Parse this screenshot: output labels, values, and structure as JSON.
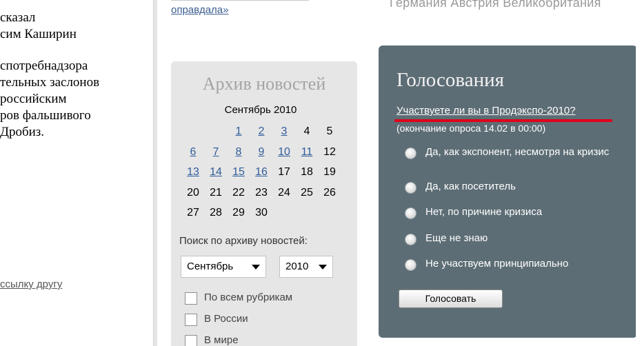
{
  "left_column": {
    "text_lines": [
      "сказал",
      "сим Каширин",
      "",
      "спотребнадзора",
      "тельных заслонов",
      "российским",
      "ров фальшивого",
      " Дробиз."
    ],
    "link": "ссылку другу"
  },
  "top": {
    "link_text": "оправдала»",
    "countries": "Германия  Австрия  Великобритания"
  },
  "archive": {
    "title": "Архив новостей",
    "month": "Сентябрь 2010",
    "calendar": [
      [
        {
          "d": "",
          "link": false
        },
        {
          "d": "",
          "link": false
        },
        {
          "d": "1",
          "link": true
        },
        {
          "d": "2",
          "link": true
        },
        {
          "d": "3",
          "link": true
        },
        {
          "d": "4",
          "link": false
        },
        {
          "d": "5",
          "link": false
        }
      ],
      [
        {
          "d": "6",
          "link": true
        },
        {
          "d": "7",
          "link": true
        },
        {
          "d": "8",
          "link": true
        },
        {
          "d": "9",
          "link": true
        },
        {
          "d": "10",
          "link": true
        },
        {
          "d": "11",
          "link": true
        },
        {
          "d": "12",
          "link": false
        }
      ],
      [
        {
          "d": "13",
          "link": true
        },
        {
          "d": "14",
          "link": true
        },
        {
          "d": "15",
          "link": true
        },
        {
          "d": "16",
          "link": true
        },
        {
          "d": "17",
          "link": false
        },
        {
          "d": "18",
          "link": false
        },
        {
          "d": "19",
          "link": false
        }
      ],
      [
        {
          "d": "20",
          "link": false
        },
        {
          "d": "21",
          "link": false
        },
        {
          "d": "22",
          "link": false
        },
        {
          "d": "23",
          "link": false
        },
        {
          "d": "24",
          "link": false
        },
        {
          "d": "25",
          "link": false
        },
        {
          "d": "26",
          "link": false
        }
      ],
      [
        {
          "d": "27",
          "link": false
        },
        {
          "d": "28",
          "link": false
        },
        {
          "d": "29",
          "link": false
        },
        {
          "d": "30",
          "link": false
        },
        {
          "d": "",
          "link": false
        },
        {
          "d": "",
          "link": false
        },
        {
          "d": "",
          "link": false
        }
      ]
    ],
    "search_label": "Поиск по архиву новостей:",
    "month_select": "Сентябрь",
    "year_select": "2010",
    "checkboxes": [
      "По всем рубрикам",
      "В России",
      "В мире"
    ]
  },
  "poll": {
    "title": "Голосования",
    "question": "Участвуете ли вы в Продэкспо-2010?",
    "deadline": "(окончание опроса 14.02 в 00:00)",
    "options": [
      "Да, как экспонент, несмотря на кризис",
      "Да, как посетитель",
      "Нет, по причине кризиса",
      "Еще не знаю",
      "Не участвуем принципиально"
    ],
    "vote_button": "Голосовать"
  },
  "colors": {
    "poll_bg": "#5d6d75",
    "archive_bg": "#e6e6e6",
    "link_blue": "#2f5c9a",
    "annotation_red": "#e0001a"
  }
}
